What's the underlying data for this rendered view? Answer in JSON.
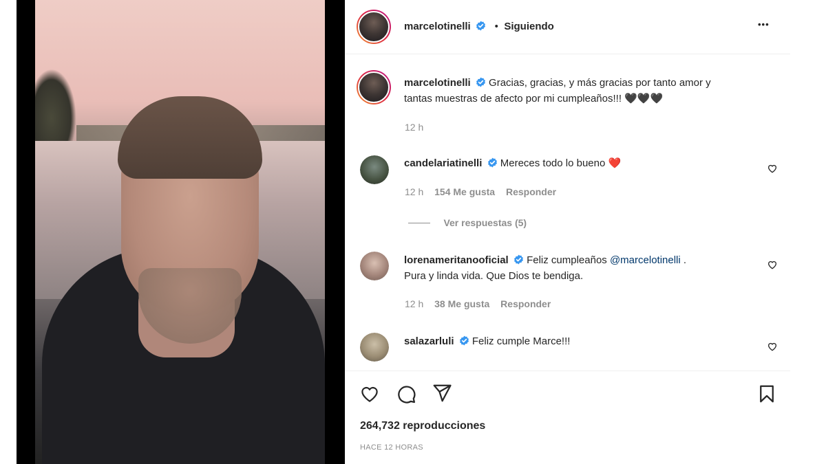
{
  "header": {
    "username": "marcelotinelli",
    "separator": "•",
    "follow_status": "Siguiendo",
    "more_label": "•••"
  },
  "caption": {
    "username": "marcelotinelli",
    "text_line1": "Gracias, gracias, y más gracias por tanto amor y",
    "text_line2": "tantas muestras de afecto por mi cumpleaños!!! 🖤🖤🖤",
    "time": "12 h"
  },
  "comments": [
    {
      "username": "candelariatinelli",
      "text": "Mereces todo lo bueno ❤️",
      "time": "12 h",
      "likes": "154 Me gusta",
      "reply": "Responder",
      "view_replies": "Ver respuestas (5)"
    },
    {
      "username": "lorenameritanooficial",
      "text_pre": "Feliz cumpleaños ",
      "mention": "@marcelotinelli",
      "text_post": " .",
      "text_line2": "Pura y linda vida. Que Dios te bendiga.",
      "time": "12 h",
      "likes": "38 Me gusta",
      "reply": "Responder"
    },
    {
      "username": "salazarluli",
      "text": "Feliz cumple Marce!!!"
    }
  ],
  "stats": {
    "views": "264,732 reproducciones",
    "posted": "HACE 12 HORAS"
  },
  "colors": {
    "verified": "#3897f0",
    "mention": "#00376b",
    "muted": "#8e8e8e"
  },
  "icons": [
    "heart-icon",
    "comment-icon",
    "share-icon",
    "bookmark-icon",
    "verified-icon",
    "more-icon"
  ]
}
